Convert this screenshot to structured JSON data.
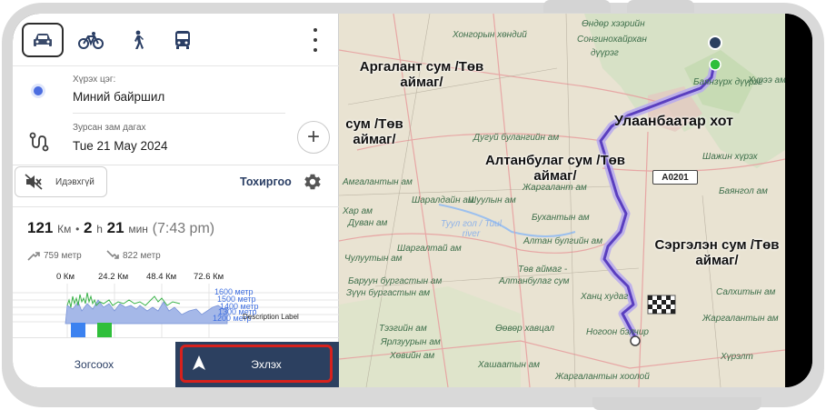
{
  "transport_modes": [
    "car",
    "bicycle",
    "pedestrian",
    "public-transport"
  ],
  "from": {
    "label": "Хүрэх цэг:",
    "value": "Миний байршил"
  },
  "route": {
    "label": "Зурсан зам дагах",
    "value": "Tue 21 May 2024"
  },
  "sound": {
    "label": "Идэвхгүй"
  },
  "settings": {
    "label": "Тохиргоо"
  },
  "summary": {
    "distance": "121",
    "distance_unit": "Км",
    "dot": "•",
    "hours": "2",
    "hours_unit": "h",
    "minutes": "21",
    "minutes_unit": "мин",
    "eta": "(7:43 pm)"
  },
  "elevation": {
    "uphill": "759 метр",
    "downhill": "822 метр"
  },
  "chart_data": {
    "type": "area",
    "x_ticks": [
      "0 Км",
      "24.2 Км",
      "48.4 Км",
      "72.6 Км"
    ],
    "y_ticks": [
      "1600 метр",
      "1500 метр",
      "1400 метр",
      "1300 метр",
      "1200 метр"
    ],
    "description": "Description Label"
  },
  "footer": {
    "cancel": "Зогсоох",
    "start": "Эхлэх"
  },
  "map": {
    "labels": {
      "argalant": "Аргалант сум /Төв\nаймаг/",
      "sum_tuv": "сум /Төв\nаймаг/",
      "ulaanbaatar": "Улаанбаатар хот",
      "altanbulag": "Алтанбулаг сум /Төв\nаймаг/",
      "sergelen": "Сэргэлэн сум /Төв\nаймаг/"
    },
    "small_labels": [
      "Хонгорын хөндий",
      "Өндөр хээрийн",
      "Сонгинохайрхан",
      "дүүрэг",
      "Баянзүрх дүүрэг",
      "Дугуй булангийн ам",
      "Жаргалант ам",
      "Шажин хүрэх",
      "Баянгол ам",
      "Бухантын ам",
      "Алтан булгийн ам",
      "Төв аймаг -",
      "Алтанбулаг сум",
      "Ханц худаг",
      "Салхитын ам",
      "Жаргалантын ам",
      "Өөвөр хавцал",
      "Ногоон бэлчир",
      "Хашаатын ам",
      "Жаргалантын хоолой",
      "Хүрэлт",
      "Хурээ ам",
      "Тээгийн ам",
      "Зүүн бургастын ам",
      "Баруун бургастын ам",
      "Ярлзуурын ам",
      "Чулуутын ам",
      "Хөвийн ам",
      "Амгалантын ам",
      "Шаралдайн ам",
      "Шаргалтай ам",
      "Хар ам",
      "Дуван ам",
      "Шуулын ам"
    ],
    "road_badge": "A0201",
    "river": "Туул гол / Tuul\nriver"
  },
  "colors": {
    "accent": "#2c4060",
    "route": "#6a4fd6",
    "highlight": "#d8211c",
    "location": "#4b6de0"
  }
}
